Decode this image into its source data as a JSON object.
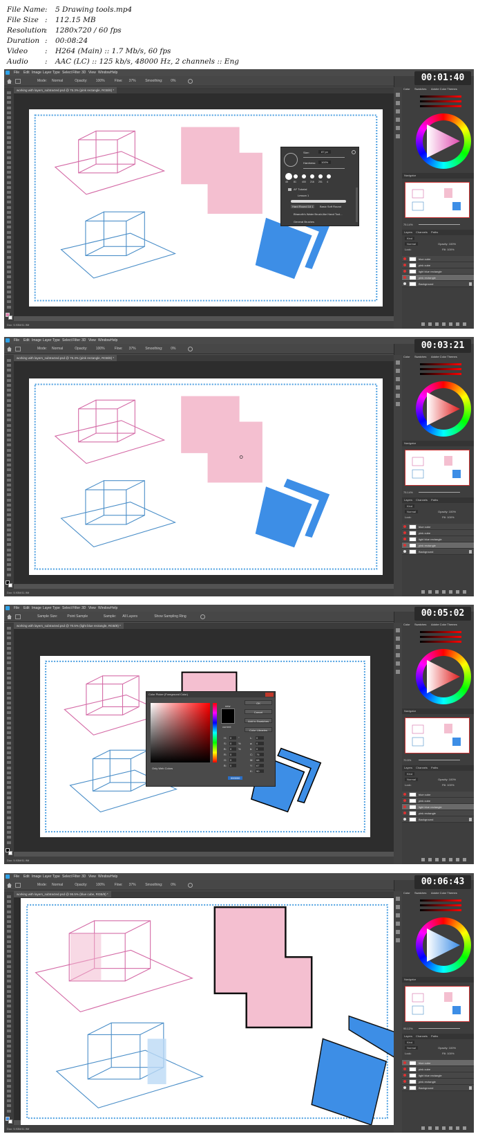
{
  "file_info": {
    "rows": [
      {
        "key": "File Name",
        "value": "5 Drawing tools.mp4"
      },
      {
        "key": "File Size",
        "value": "112.15 MB"
      },
      {
        "key": "Resolution",
        "value": "1280x720 / 60 fps"
      },
      {
        "key": "Duration",
        "value": "00:08:24"
      },
      {
        "key": "Video",
        "value": "H264 (Main) :: 1.7 Mb/s, 60 fps"
      },
      {
        "key": "Audio",
        "value": "AAC (LC) :: 125 kb/s, 48000 Hz, 2 channels :: Eng"
      }
    ],
    "separator": ":"
  },
  "menu": [
    "File",
    "Edit",
    "Image",
    "Layer",
    "Type",
    "Select",
    "Filter",
    "3D",
    "View",
    "Window",
    "Help"
  ],
  "panel_tabs": {
    "color": "Color",
    "swatches": "Swatches",
    "themes": "Adobe Color Themes"
  },
  "navigator_label": "Navigator",
  "layers_tabs": {
    "layers": "Layers",
    "channels": "Channels",
    "paths": "Paths"
  },
  "layers_opts": {
    "kind": "Kind",
    "mode": "Normal",
    "opacity": "Opacity: 100%",
    "lock": "Lock:",
    "fill": "Fill: 100%"
  },
  "frames": [
    {
      "timestamp": "00:01:40",
      "tab_title": "working with layers_subtracted.psd @ 75.3% (pink rectangle, RGB/8) *",
      "options": [
        "Mode:",
        "Normal",
        "Opacity:",
        "100%",
        "Flow:",
        "37%",
        "Smoothing:",
        "0%"
      ],
      "zoom": "75.14%",
      "status": "Doc: 5.93M/11.9M",
      "layers": [
        "blue cube",
        "pink cube",
        "light blue rectangle",
        "pink rectangle",
        "Background"
      ],
      "selected_layer": 3,
      "popup": {
        "size_label": "Size:",
        "size_value": "87 px",
        "hardness_label": "Hardness:",
        "hardness_value": "100%",
        "presets": [
          "45",
          "81",
          "400",
          "216",
          "251",
          "4"
        ],
        "folder1": "AF Tutorial",
        "folder1_item": "Lesson 1",
        "brush_name": "Hard Round 18 1",
        "brush_name2": "Basic Soft Round",
        "folder2": "Bhanoth's Water Brush-like Hand Tool...",
        "folder3": "General Brushes"
      }
    },
    {
      "timestamp": "00:03:21",
      "tab_title": "working with layers_subtracted.psd @ 75.3% (pink rectangle, RGB/8) *",
      "options": [
        "Mode:",
        "Normal",
        "Opacity:",
        "100%",
        "Flow:",
        "37%",
        "Smoothing:",
        "0%"
      ],
      "zoom": "75.14%",
      "status": "Doc: 5.93M/11.9M",
      "layers": [
        "blue cube",
        "pink cube",
        "light blue rectangle",
        "pink rectangle",
        "Background"
      ],
      "selected_layer": 3
    },
    {
      "timestamp": "00:05:02",
      "tab_title": "working with layers_subtracted.psd @ 70.5% (light blue rectangle, RGB/8) *",
      "options": [
        "Sample Size:",
        "Point Sample",
        "Sample:",
        "All Layers",
        "Show Sampling Ring"
      ],
      "zoom": "70.5%",
      "status": "Doc: 5.93M/11.9M",
      "layers": [
        "blue cube",
        "pink cube",
        "light blue rectangle",
        "pink rectangle",
        "Background"
      ],
      "selected_layer": 2,
      "picker": {
        "title": "Color Picker (Foreground Color)",
        "ok": "OK",
        "cancel": "Cancel",
        "add": "Add to Swatches",
        "libraries": "Color Libraries",
        "new_label": "new",
        "current_label": "current",
        "only_web": "Only Web Colors",
        "hex": "000000",
        "fields": [
          [
            "H:",
            "0",
            "°"
          ],
          [
            "S:",
            "0",
            "%"
          ],
          [
            "B:",
            "0",
            "%"
          ],
          [
            "R:",
            "0",
            ""
          ],
          [
            "G:",
            "0",
            ""
          ],
          [
            "B:",
            "0",
            ""
          ]
        ],
        "fields2": [
          [
            "L:",
            "0"
          ],
          [
            "a:",
            "0"
          ],
          [
            "b:",
            "0"
          ],
          [
            "C:",
            "75"
          ],
          [
            "M:",
            "68"
          ],
          [
            "Y:",
            "67"
          ],
          [
            "K:",
            "90"
          ]
        ]
      }
    },
    {
      "timestamp": "00:06:43",
      "tab_title": "working with layers_subtracted.psd @ 95.5% (blue cube, RGB/8) *",
      "options": [
        "Mode:",
        "Normal",
        "Opacity:",
        "100%",
        "Flow:",
        "37%",
        "Smoothing:",
        "0%"
      ],
      "zoom": "95.12%",
      "status": "Doc: 5.93M/11.9M",
      "layers": [
        "blue cube",
        "pink cube",
        "light blue rectangle",
        "pink rectangle",
        "Background"
      ],
      "selected_layer": 0
    }
  ],
  "colors": {
    "pink": "#f4bfd0",
    "blue": "#3d8ee6",
    "pink_line": "#d46aa6",
    "blue_line": "#4a8ec8",
    "dotted": "#4a9ee0"
  }
}
